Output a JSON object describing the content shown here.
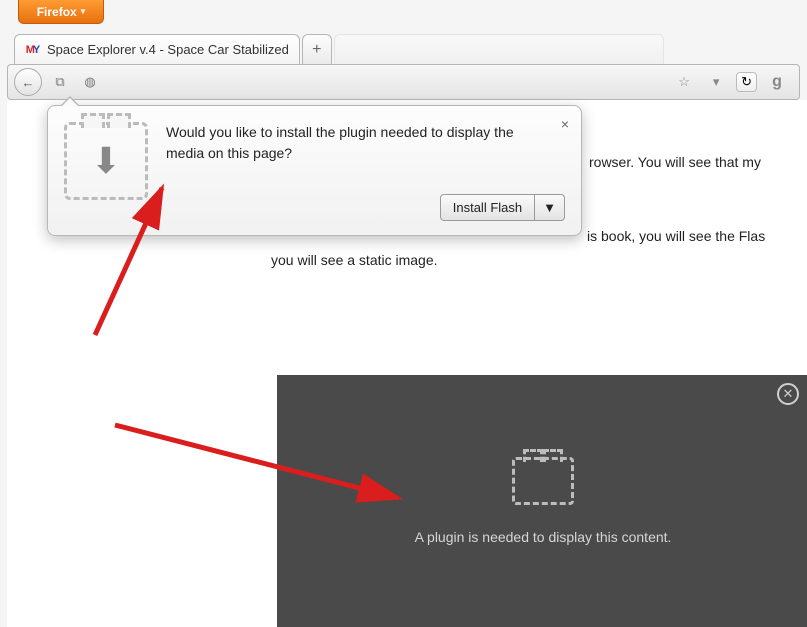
{
  "firefox_button": {
    "label": "Firefox"
  },
  "tabs": {
    "active": {
      "title": "Space Explorer v.4 - Space Car Stabilized"
    },
    "new_tab_glyph": "+"
  },
  "navbar": {
    "back_glyph": "←",
    "group_glyph": "⧉",
    "globe_glyph": "◍",
    "star_glyph": "☆",
    "dropdown_glyph": "▾",
    "reload_glyph": "↻",
    "google_glyph": "g"
  },
  "page_text": {
    "line1_fragment": "rowser. You will see that my",
    "line2_fragment": "is book, you will see the Flas",
    "line3": "you will see a static image."
  },
  "doorhanger": {
    "message": "Would you like to install the plugin needed to display the media on this page?",
    "close_glyph": "×",
    "install_label": "Install Flash",
    "dropdown_glyph": "▼",
    "download_arrow": "⬇"
  },
  "flash_placeholder": {
    "message": "A plugin is needed to display this content.",
    "close_glyph": "✕"
  }
}
